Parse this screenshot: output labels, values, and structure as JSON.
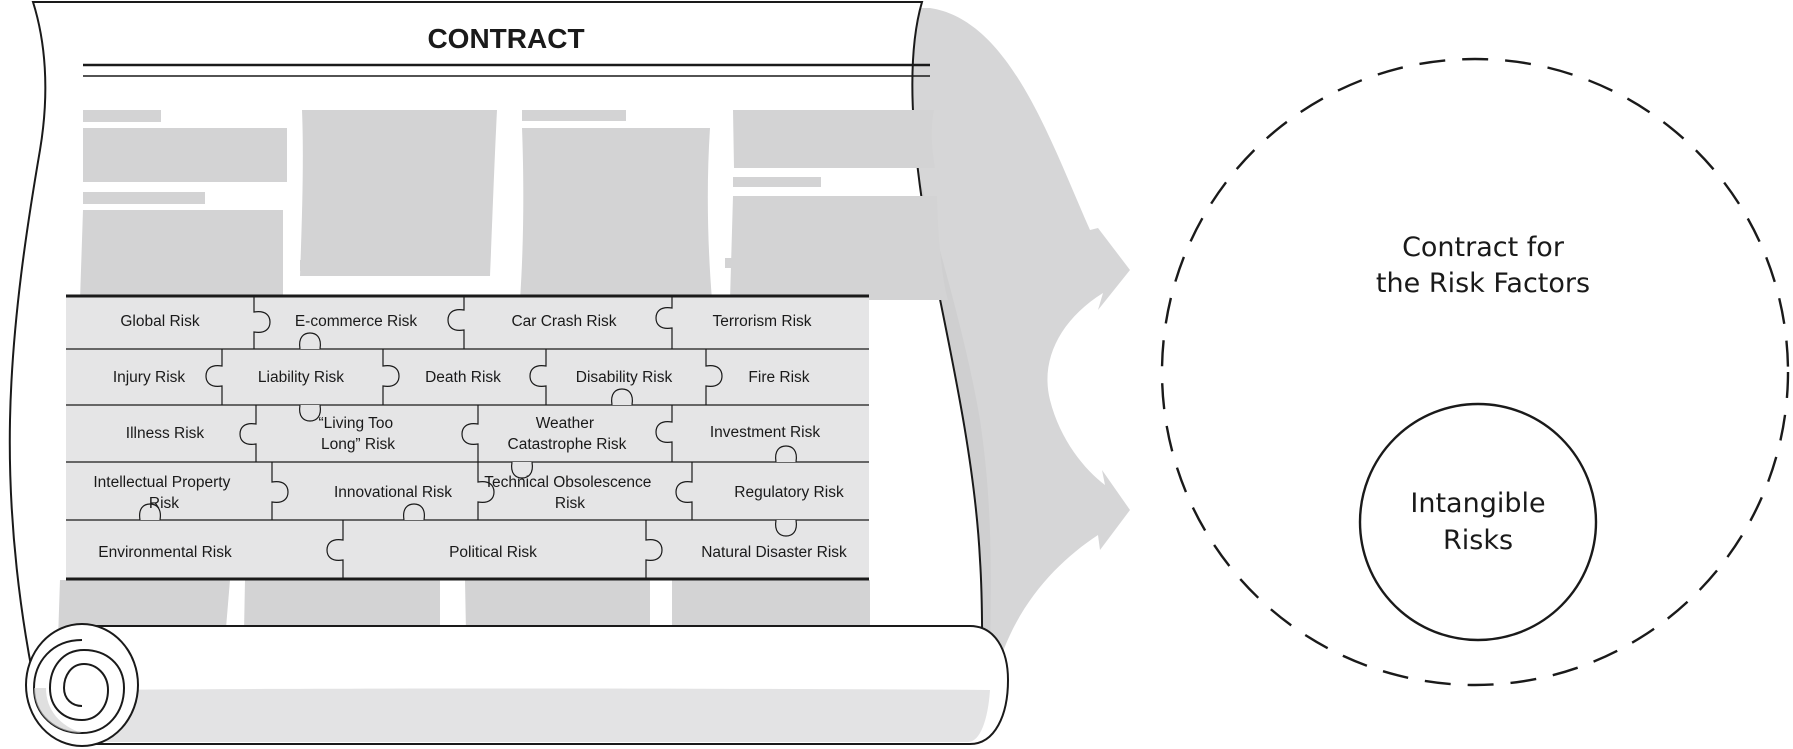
{
  "contract": {
    "title": "CONTRACT"
  },
  "puzzle": {
    "rows": [
      [
        "Global Risk",
        "E-commerce Risk",
        "Car Crash Risk",
        "Terrorism Risk"
      ],
      [
        "Injury Risk",
        "Liability Risk",
        "Death Risk",
        "Disability Risk",
        "Fire Risk"
      ],
      [
        "Illness Risk",
        "“Living Too Long” Risk",
        "Weather Catastrophe Risk",
        "Investment Risk"
      ],
      [
        "Intellectual Property Risk",
        "Innovational Risk",
        "Technical Obsolescence Risk",
        "Regulatory Risk"
      ],
      [
        "Environmental Risk",
        "Political Risk",
        "Natural Disaster Risk"
      ]
    ]
  },
  "outer_circle": {
    "line1": "Contract for",
    "line2": "the Risk Factors"
  },
  "inner_circle": {
    "line1": "Intangible",
    "line2": "Risks"
  },
  "colors": {
    "shadow": "#d6d6d7",
    "paper": "#ffffff",
    "block": "#d3d3d4",
    "piece": "#e5e5e6",
    "stroke": "#1a1a1a"
  }
}
